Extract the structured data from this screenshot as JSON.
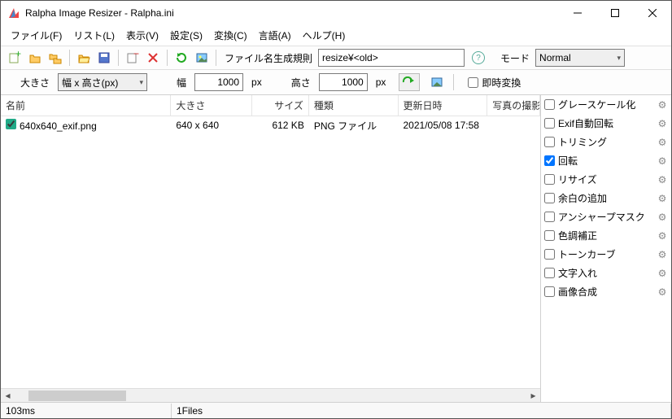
{
  "window": {
    "title": "Ralpha Image Resizer - Ralpha.ini"
  },
  "menu": {
    "file": "ファイル(F)",
    "list": "リスト(L)",
    "view": "表示(V)",
    "settings": "設定(S)",
    "convert": "変換(C)",
    "lang": "言語(A)",
    "help": "ヘルプ(H)"
  },
  "toolbar": {
    "rule_label": "ファイル名生成規則",
    "rule_value": "resize¥<old>",
    "mode_label": "モード",
    "mode_value": "Normal"
  },
  "sizebar": {
    "size_label": "大きさ",
    "size_mode": "幅 x 高さ(px)",
    "width_label": "幅",
    "width_value": "1000",
    "width_unit": "px",
    "height_label": "高さ",
    "height_value": "1000",
    "height_unit": "px",
    "instant_label": "即時変換"
  },
  "columns": {
    "name": "名前",
    "size": "大きさ",
    "fsize": "サイズ",
    "type": "種類",
    "date": "更新日時",
    "photo": "写真の撮影日"
  },
  "rows": [
    {
      "checked": true,
      "name": "640x640_exif.png",
      "size": "640 x 640",
      "fsize": "612 KB",
      "type": "PNG ファイル",
      "date": "2021/05/08 17:58"
    }
  ],
  "ops": {
    "grayscale": {
      "label": "グレースケール化",
      "checked": false
    },
    "exif": {
      "label": "Exif自動回転",
      "checked": false
    },
    "trim": {
      "label": "トリミング",
      "checked": false
    },
    "rotate": {
      "label": "回転",
      "checked": true
    },
    "resize": {
      "label": "リサイズ",
      "checked": false
    },
    "margin": {
      "label": "余白の追加",
      "checked": false
    },
    "unsharp": {
      "label": "アンシャープマスク",
      "checked": false
    },
    "color": {
      "label": "色調補正",
      "checked": false
    },
    "tone": {
      "label": "トーンカーブ",
      "checked": false
    },
    "text": {
      "label": "文字入れ",
      "checked": false
    },
    "compose": {
      "label": "画像合成",
      "checked": false
    }
  },
  "status": {
    "time": "103ms",
    "files": "1Files"
  }
}
